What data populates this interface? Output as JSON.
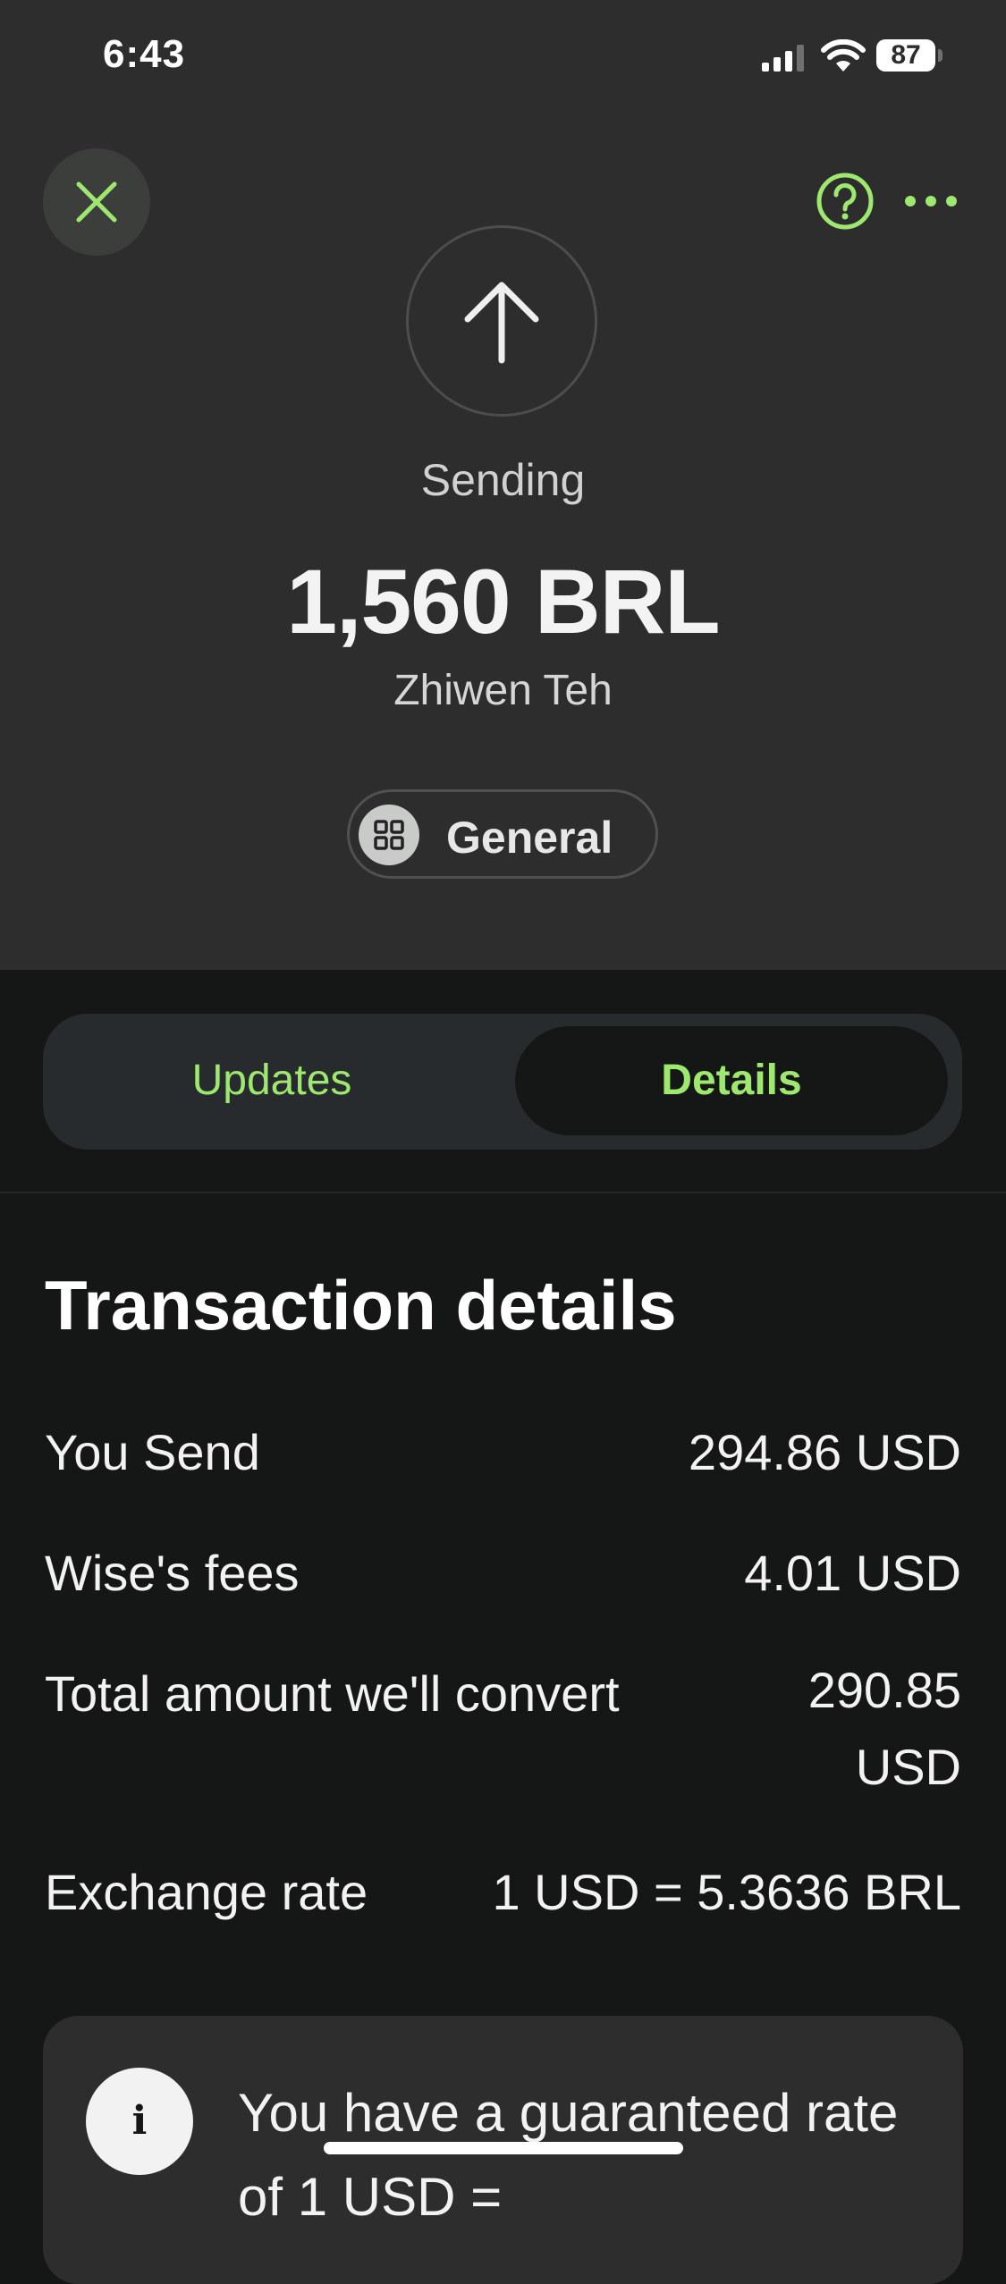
{
  "statusbar": {
    "time": "6:43",
    "battery": "87"
  },
  "header": {
    "close_icon": "close-icon",
    "help_icon": "help-circle-icon",
    "more_icon": "more-dots-icon",
    "accent_color": "#9fe870"
  },
  "hero": {
    "icon": "arrow-up-icon",
    "status": "Sending",
    "amount": "1,560 BRL",
    "recipient": "Zhiwen Teh",
    "category": {
      "icon": "grid-icon",
      "label": "General"
    }
  },
  "tabs": {
    "items": [
      {
        "label": "Updates",
        "selected": false
      },
      {
        "label": "Details",
        "selected": true
      }
    ]
  },
  "details": {
    "title": "Transaction details",
    "rows": [
      {
        "label": "You Send",
        "value": "294.86 USD"
      },
      {
        "label": "Wise's fees",
        "value": "4.01 USD"
      },
      {
        "label": "Total amount we'll convert",
        "value": "290.85 USD"
      },
      {
        "label": "Exchange rate",
        "value": "1 USD = 5.3636 BRL"
      }
    ]
  },
  "info_card": {
    "icon": "info-icon",
    "icon_glyph": "i",
    "text": "You have a guaranteed rate of 1 USD ="
  }
}
